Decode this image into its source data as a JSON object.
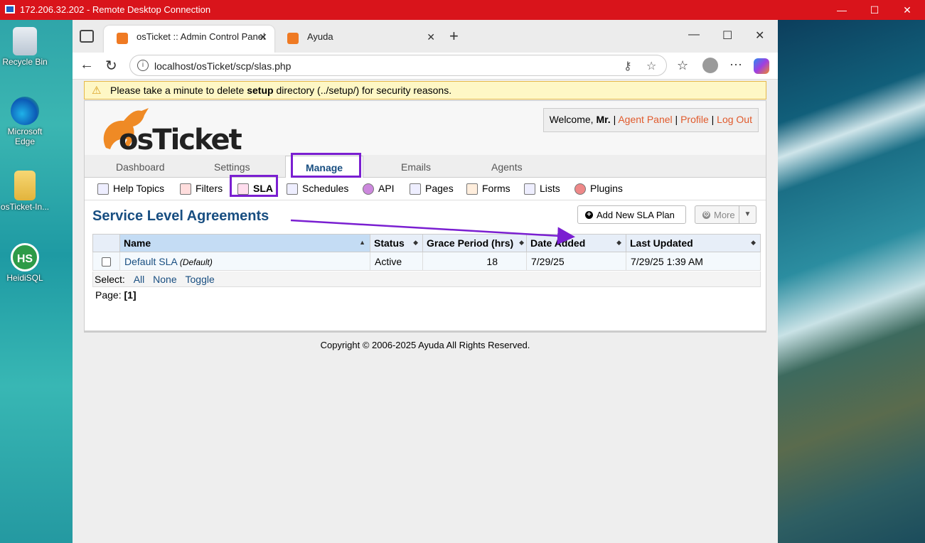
{
  "rdp": {
    "title": "172.206.32.202 - Remote Desktop Connection",
    "minimize": "—",
    "maximize": "☐",
    "close": "✕"
  },
  "desktop": {
    "icons": [
      {
        "label": "Recycle Bin"
      },
      {
        "label": "Microsoft Edge"
      },
      {
        "label": "osTicket-In..."
      },
      {
        "label": "HeidiSQL"
      }
    ]
  },
  "browser": {
    "tabs": [
      {
        "label": "osTicket :: Admin Control Panel"
      },
      {
        "label": "Ayuda"
      }
    ],
    "url": "localhost/osTicket/scp/slas.php",
    "new_tab": "+"
  },
  "warning": {
    "prefix": "Please take a minute to delete ",
    "bold": "setup",
    "suffix": " directory (../setup/) for security reasons."
  },
  "header": {
    "logo_text": "osTicket",
    "welcome_prefix": "Welcome, ",
    "user": "Mr.",
    "links": [
      "Agent Panel",
      "Profile",
      "Log Out"
    ],
    "separator": "|"
  },
  "nav": {
    "items": [
      "Dashboard",
      "Settings",
      "Manage",
      "Emails",
      "Agents"
    ],
    "active": "Manage"
  },
  "subnav": {
    "items": [
      "Help Topics",
      "Filters",
      "SLA",
      "Schedules",
      "API",
      "Pages",
      "Forms",
      "Lists",
      "Plugins"
    ],
    "active": "SLA"
  },
  "page": {
    "title": "Service Level Agreements",
    "add_button": "Add New SLA Plan",
    "more_button": "More"
  },
  "table": {
    "headers": [
      "Name",
      "Status",
      "Grace Period (hrs)",
      "Date Added",
      "Last Updated"
    ],
    "rows": [
      {
        "name": "Default SLA",
        "tag": "(Default)",
        "status": "Active",
        "grace": "18",
        "added": "7/29/25",
        "updated": "7/29/25 1:39 AM"
      }
    ]
  },
  "select": {
    "label": "Select:",
    "all": "All",
    "none": "None",
    "toggle": "Toggle"
  },
  "pager": {
    "label": "Page:",
    "current": "[1]"
  },
  "footer": "Copyright © 2006-2025 Ayuda All Rights Reserved.",
  "colors": {
    "accent": "#7a1fd1",
    "brand_blue": "#184e81",
    "link_orange": "#e05a2c",
    "rdp_red": "#d9141b"
  }
}
